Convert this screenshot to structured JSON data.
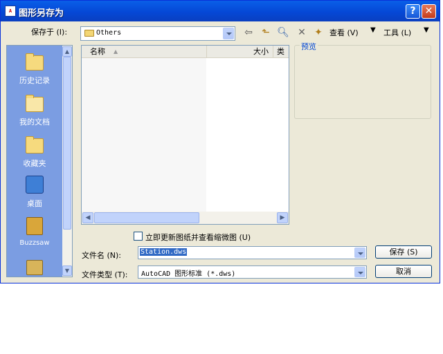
{
  "window": {
    "title": "图形另存为",
    "app_icon_text": "A"
  },
  "toolbar": {
    "save_in_label": "保存于 (I):",
    "location": "Others",
    "view_label": "查看 (V)",
    "tools_label": "工具 (L)"
  },
  "places": [
    {
      "label": "历史记录",
      "icon": "history-folder-icon"
    },
    {
      "label": "我的文档",
      "icon": "my-documents-icon"
    },
    {
      "label": "收藏夹",
      "icon": "favorites-folder-icon"
    },
    {
      "label": "桌面",
      "icon": "desktop-icon"
    },
    {
      "label": "Buzzsaw",
      "icon": "buzzsaw-icon"
    }
  ],
  "filelist": {
    "col_name": "名称",
    "col_size": "大小",
    "col_type": "类"
  },
  "preview": {
    "label": "预览"
  },
  "options": {
    "update_thumbnail_label": "立即更新图纸并查看缩微图 (U)"
  },
  "filename": {
    "label": "文件名 (N):",
    "value": "Station.dws"
  },
  "filetype": {
    "label": "文件类型 (T):",
    "value": "AutoCAD 图形标准 (*.dws)"
  },
  "buttons": {
    "save": "保存 (S)",
    "cancel": "取消"
  },
  "colors": {
    "title_bar": "#0A5FE8",
    "dialog_bg": "#ECE9D8",
    "places_bar": "#7B9DE2",
    "selection": "#316AC5"
  }
}
